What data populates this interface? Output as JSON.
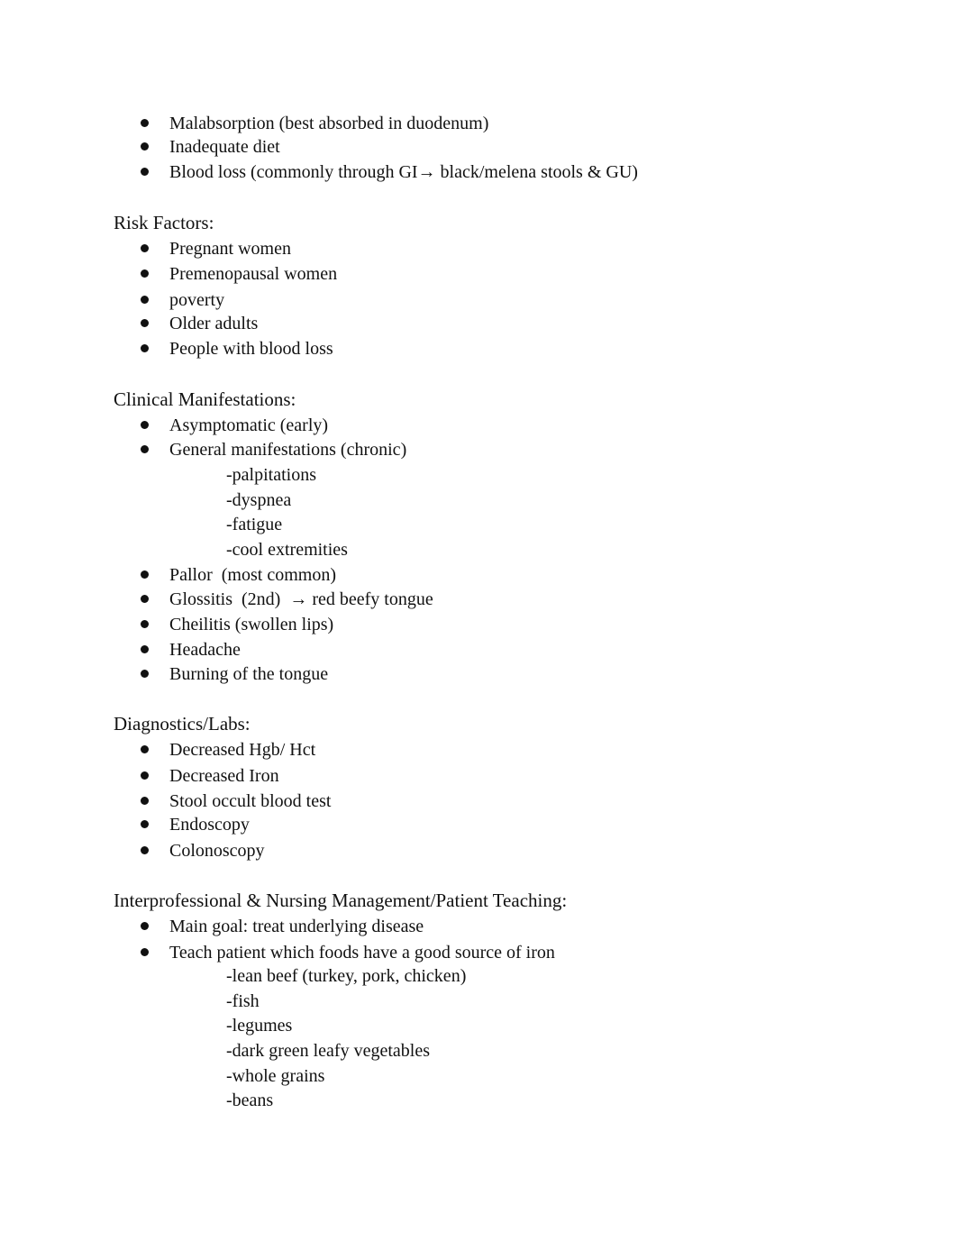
{
  "intro_bullets": [
    "Malabsorption (best absorbed in duodenum)",
    "Inadequate diet",
    "Blood loss (commonly through GI→ black/melena stools & GU)"
  ],
  "sections": [
    {
      "heading": "Risk Factors:",
      "items": [
        {
          "text": "Pregnant women"
        },
        {
          "text": "Premenopausal women"
        },
        {
          "text": "poverty"
        },
        {
          "text": "Older adults"
        },
        {
          "text": "People with blood loss"
        }
      ]
    },
    {
      "heading": "Clinical Manifestations:",
      "items": [
        {
          "text": "Asymptomatic (early)"
        },
        {
          "text": "General manifestations (chronic)",
          "subitems": [
            "-palpitations",
            "-dyspnea",
            "-fatigue",
            "-cool extremities"
          ]
        },
        {
          "text": "Pallor  (most common)"
        },
        {
          "text": "Glossitis  (2nd)  → red beefy tongue"
        },
        {
          "text": "Cheilitis (swollen lips)"
        },
        {
          "text": "Headache"
        },
        {
          "text": "Burning of the tongue"
        }
      ]
    },
    {
      "heading": "Diagnostics/Labs:",
      "items": [
        {
          "text": "Decreased Hgb/ Hct"
        },
        {
          "text": "Decreased Iron"
        },
        {
          "text": "Stool occult blood test"
        },
        {
          "text": "Endoscopy"
        },
        {
          "text": "Colonoscopy"
        }
      ]
    },
    {
      "heading": "Interprofessional & Nursing Management/Patient Teaching:",
      "items": [
        {
          "text": "Main goal: treat underlying disease"
        },
        {
          "text": "Teach patient which foods have a good source of iron",
          "subitems": [
            "-lean beef (turkey, pork, chicken)",
            "-fish",
            "-legumes",
            "-dark green leafy vegetables",
            "-whole grains",
            "-beans"
          ]
        }
      ]
    }
  ]
}
